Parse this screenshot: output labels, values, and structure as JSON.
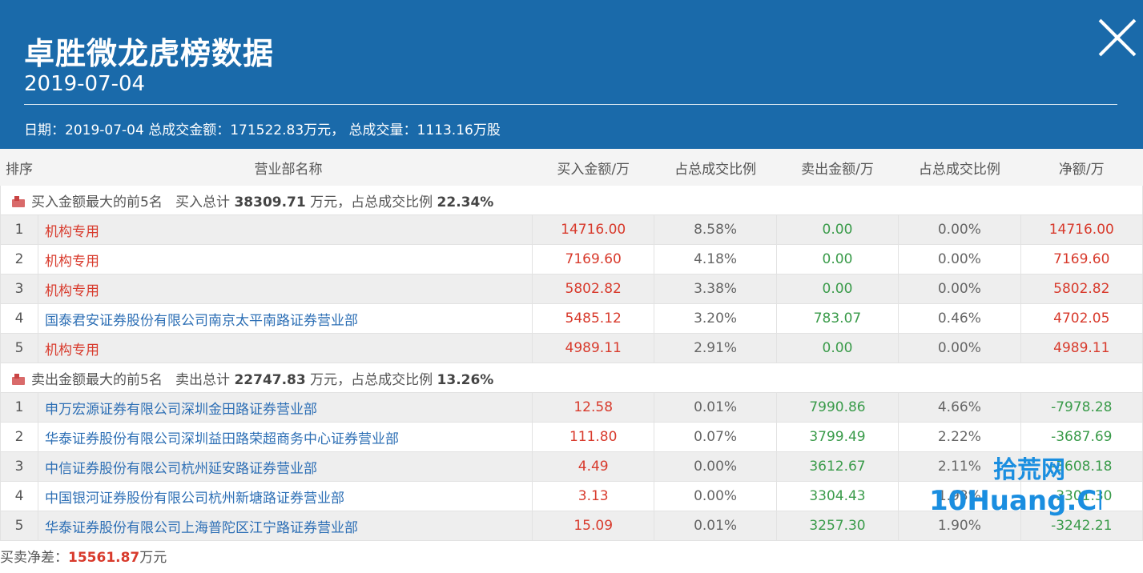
{
  "header": {
    "title": "卓胜微龙虎榜数据",
    "date": "2019-07-04",
    "summary": "日期：2019-07-04 总成交金额：171522.83万元， 总成交量：1113.16万股"
  },
  "columns": [
    "排序",
    "营业部名称",
    "买入金额/万",
    "占总成交比例",
    "卖出金额/万",
    "占总成交比例",
    "净额/万"
  ],
  "buy_group": {
    "prefix": "买入金额最大的前5名",
    "total_label": "买入总计",
    "total": "38309.71",
    "unit_ratio": "万元，占总成交比例",
    "ratio": "22.34%"
  },
  "buy_rows": [
    {
      "rank": "1",
      "name": "机构专用",
      "buy": "14716.00",
      "buy_pct": "8.58%",
      "sell": "0.00",
      "sell_pct": "0.00%",
      "net": "14716.00"
    },
    {
      "rank": "2",
      "name": "机构专用",
      "buy": "7169.60",
      "buy_pct": "4.18%",
      "sell": "0.00",
      "sell_pct": "0.00%",
      "net": "7169.60"
    },
    {
      "rank": "3",
      "name": "机构专用",
      "buy": "5802.82",
      "buy_pct": "3.38%",
      "sell": "0.00",
      "sell_pct": "0.00%",
      "net": "5802.82"
    },
    {
      "rank": "4",
      "name": "国泰君安证券股份有限公司南京太平南路证券营业部",
      "buy": "5485.12",
      "buy_pct": "3.20%",
      "sell": "783.07",
      "sell_pct": "0.46%",
      "net": "4702.05"
    },
    {
      "rank": "5",
      "name": "机构专用",
      "buy": "4989.11",
      "buy_pct": "2.91%",
      "sell": "0.00",
      "sell_pct": "0.00%",
      "net": "4989.11"
    }
  ],
  "sell_group": {
    "prefix": "卖出金额最大的前5名",
    "total_label": "卖出总计",
    "total": "22747.83",
    "unit_ratio": "万元，占总成交比例",
    "ratio": "13.26%"
  },
  "sell_rows": [
    {
      "rank": "1",
      "name": "申万宏源证券有限公司深圳金田路证券营业部",
      "buy": "12.58",
      "buy_pct": "0.01%",
      "sell": "7990.86",
      "sell_pct": "4.66%",
      "net": "-7978.28"
    },
    {
      "rank": "2",
      "name": "华泰证券股份有限公司深圳益田路荣超商务中心证券营业部",
      "buy": "111.80",
      "buy_pct": "0.07%",
      "sell": "3799.49",
      "sell_pct": "2.22%",
      "net": "-3687.69"
    },
    {
      "rank": "3",
      "name": "中信证券股份有限公司杭州延安路证券营业部",
      "buy": "4.49",
      "buy_pct": "0.00%",
      "sell": "3612.67",
      "sell_pct": "2.11%",
      "net": "-3608.18"
    },
    {
      "rank": "4",
      "name": "中国银河证券股份有限公司杭州新塘路证券营业部",
      "buy": "3.13",
      "buy_pct": "0.00%",
      "sell": "3304.43",
      "sell_pct": "1.93%",
      "net": "-3301.30"
    },
    {
      "rank": "5",
      "name": "华泰证券股份有限公司上海普陀区江宁路证券营业部",
      "buy": "15.09",
      "buy_pct": "0.01%",
      "sell": "3257.30",
      "sell_pct": "1.90%",
      "net": "-3242.21"
    }
  ],
  "footer": {
    "label": "买卖净差：",
    "value": "15561.87",
    "unit": "万元"
  },
  "watermark_logo": {
    "cn": "拾荒网",
    "en": "10Huang.CN"
  },
  "colors": {
    "header_bg": "#1a6aaa",
    "buy_red": "#d83a2c",
    "sell_green": "#3a9b4a",
    "link_blue": "#2d6fb5"
  },
  "icons": {
    "close": "close-icon",
    "group_marker": "flag-icon"
  }
}
